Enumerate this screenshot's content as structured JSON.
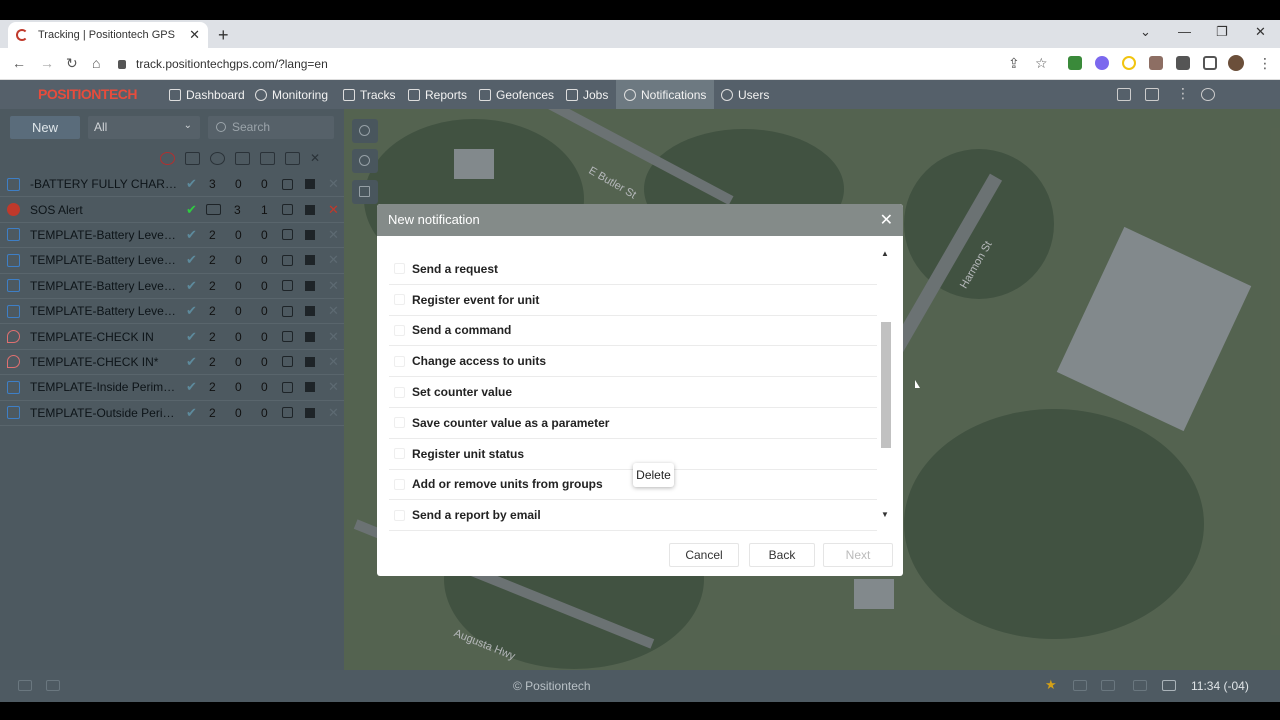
{
  "browser": {
    "tab_title": "Tracking | Positiontech GPS",
    "url": "track.positiontechgps.com/?lang=en"
  },
  "app": {
    "logo": "POSITIONTECH",
    "nav": [
      {
        "label": "Dashboard",
        "icon": "bar-chart-icon"
      },
      {
        "label": "Monitoring",
        "icon": "globe-icon"
      },
      {
        "label": "Tracks",
        "icon": "map-icon"
      },
      {
        "label": "Reports",
        "icon": "document-icon"
      },
      {
        "label": "Geofences",
        "icon": "geofence-icon"
      },
      {
        "label": "Jobs",
        "icon": "clipboard-icon"
      },
      {
        "label": "Notifications",
        "icon": "alarm-icon"
      },
      {
        "label": "Users",
        "icon": "user-icon"
      }
    ]
  },
  "sidebar": {
    "new_label": "New",
    "filter_value": "All",
    "search_placeholder": "Search",
    "rows": [
      {
        "name": "-BATTERY FULLY CHARGE...",
        "c1": "3",
        "c2": "0",
        "c3": "0",
        "kind": "template"
      },
      {
        "name": "SOS Alert",
        "c1": "3",
        "c2": "1",
        "c3": "",
        "kind": "sos"
      },
      {
        "name": "TEMPLATE-Battery Level 1...",
        "c1": "2",
        "c2": "0",
        "c3": "0",
        "kind": "template"
      },
      {
        "name": "TEMPLATE-Battery Level 2...",
        "c1": "2",
        "c2": "0",
        "c3": "0",
        "kind": "template"
      },
      {
        "name": "TEMPLATE-Battery Level 5...",
        "c1": "2",
        "c2": "0",
        "c3": "0",
        "kind": "template"
      },
      {
        "name": "TEMPLATE-Battery Level 7...",
        "c1": "2",
        "c2": "0",
        "c3": "0",
        "kind": "template"
      },
      {
        "name": "TEMPLATE-CHECK IN",
        "c1": "2",
        "c2": "0",
        "c3": "0",
        "kind": "pin"
      },
      {
        "name": "TEMPLATE-CHECK IN*",
        "c1": "2",
        "c2": "0",
        "c3": "0",
        "kind": "pin"
      },
      {
        "name": "TEMPLATE-Inside Perimeter",
        "c1": "2",
        "c2": "0",
        "c3": "0",
        "kind": "geo"
      },
      {
        "name": "TEMPLATE-Outside Perim...",
        "c1": "2",
        "c2": "0",
        "c3": "0",
        "kind": "geo"
      }
    ]
  },
  "map": {
    "labels": [
      "E Butler St",
      "Harmon St",
      "Augusta Hwy"
    ]
  },
  "modal": {
    "title": "New notification",
    "actions": [
      "Send a request",
      "Register event for unit",
      "Send a command",
      "Change access to units",
      "Set counter value",
      "Save counter value as a parameter",
      "Register unit status",
      "Add or remove units from groups",
      "Send a report by email"
    ],
    "tooltip": "Delete",
    "cancel_label": "Cancel",
    "back_label": "Back",
    "next_label": "Next"
  },
  "footer": {
    "copyright": "© Positiontech",
    "time": "11:34 (-04)"
  }
}
